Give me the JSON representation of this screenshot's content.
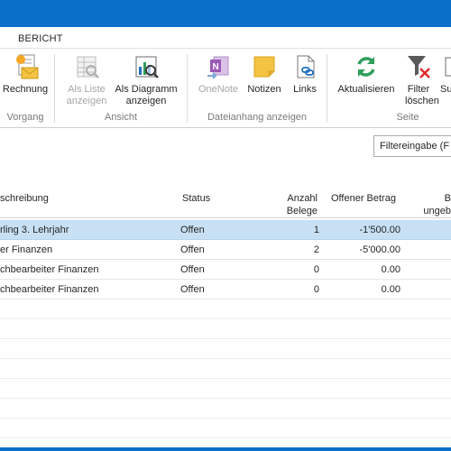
{
  "ribbon": {
    "tab": "BERICHT",
    "buttons": {
      "rechnung": "Rechnung",
      "als_liste": "Als Liste anzeigen",
      "als_diagramm": "Als Diagramm anzeigen",
      "onenote": "OneNote",
      "notizen": "Notizen",
      "links": "Links",
      "aktualisieren": "Aktualisieren",
      "filter_loeschen": "Filter löschen",
      "truncated": "Su"
    },
    "groups": {
      "vorgang": "Vorgang",
      "ansicht": "Ansicht",
      "dateianhang": "Dateianhang anzeigen",
      "seite": "Seite"
    }
  },
  "filter": {
    "placeholder": "Filtereingabe (F"
  },
  "table": {
    "headers": {
      "beschreibung": "schreibung",
      "status": "Status",
      "anzahl_belege": "Anzahl Belege",
      "offener_betrag": "Offener Betrag",
      "truncated": "B ungeb"
    },
    "rows": [
      {
        "beschreibung": "rling 3. Lehrjahr",
        "status": "Offen",
        "anzahl": "1",
        "betrag": "-1'500.00",
        "selected": true
      },
      {
        "beschreibung": "er Finanzen",
        "status": "Offen",
        "anzahl": "2",
        "betrag": "-5'000.00",
        "selected": false
      },
      {
        "beschreibung": "chbearbeiter Finanzen",
        "status": "Offen",
        "anzahl": "0",
        "betrag": "0.00",
        "selected": false
      },
      {
        "beschreibung": "chbearbeiter Finanzen",
        "status": "Offen",
        "anzahl": "0",
        "betrag": "0.00",
        "selected": false
      }
    ]
  },
  "colors": {
    "accent": "#0a6fc9",
    "selection": "#c7e0f4"
  }
}
